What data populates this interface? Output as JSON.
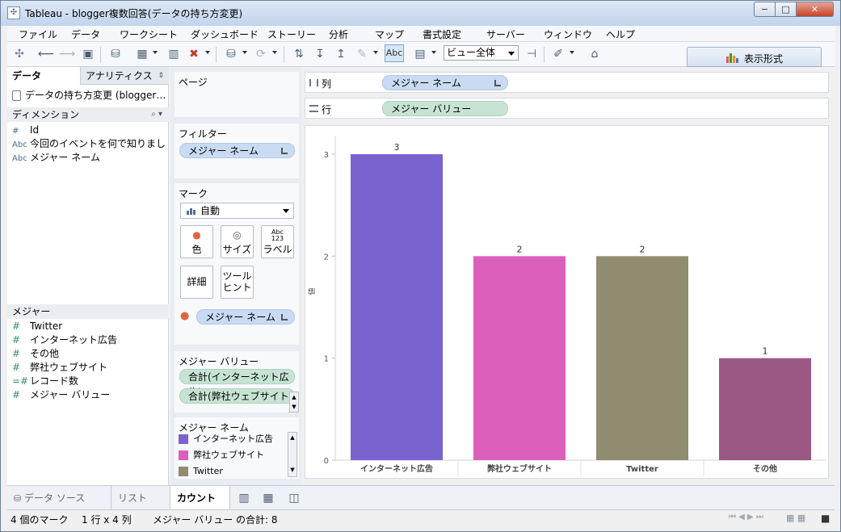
{
  "window": {
    "title": "Tableau - blogger複数回答(データの持ち方変更)",
    "min": "−",
    "max": "□",
    "close": "✕"
  },
  "menu": [
    "ファイル",
    "データ",
    "ワークシート",
    "ダッシュボード",
    "ストーリー",
    "分析",
    "マップ",
    "書式設定",
    "サーバー",
    "ウィンドウ",
    "ヘルプ"
  ],
  "toolbar": {
    "abc": "Abc",
    "view_select": "ビュー全体",
    "showme": "表示形式"
  },
  "left_pane": {
    "tab_data": "データ",
    "tab_analytics": "アナリティクス",
    "datasource": "データの持ち方変更 (blogger…",
    "dimensions_header": "ディメンション",
    "dimensions": [
      {
        "type": "#",
        "name": "Id"
      },
      {
        "type": "Abc",
        "name": "今回のイベントを何で知りました…"
      },
      {
        "type": "Abc",
        "name": "メジャー ネーム"
      }
    ],
    "measures_header": "メジャー",
    "measures": [
      {
        "type": "#",
        "name": "Twitter"
      },
      {
        "type": "#",
        "name": "インターネット広告"
      },
      {
        "type": "#",
        "name": "その他"
      },
      {
        "type": "#",
        "name": "弊社ウェブサイト"
      },
      {
        "type": "=#",
        "name": "レコード数"
      },
      {
        "type": "#",
        "name": "メジャー バリュー"
      }
    ]
  },
  "cards": {
    "pages": "ページ",
    "filters": "フィルター",
    "filter_pill": "メジャー ネーム",
    "marks": "マーク",
    "mark_type": "自動",
    "mark_buttons": [
      {
        "label": "色",
        "icon": "●"
      },
      {
        "label": "サイズ",
        "icon": "◎"
      },
      {
        "label": "ラベル",
        "icon": "Abc\n123"
      },
      {
        "label": "詳細",
        "icon": ""
      },
      {
        "label": "ツール\nヒント",
        "icon": ""
      }
    ],
    "color_pill": "メジャー ネーム",
    "measure_values_header": "メジャー バリュー",
    "measure_values_pills": [
      "合計(インターネット広告)",
      "合計(弊社ウェブサイト)"
    ],
    "legend_header": "メジャー ネーム",
    "legend_items": [
      {
        "name": "インターネット広告",
        "color": "#7b63cf"
      },
      {
        "name": "弊社ウェブサイト",
        "color": "#dc5fbc"
      },
      {
        "name": "Twitter",
        "color": "#908c70"
      }
    ]
  },
  "shelves": {
    "columns_label": "列",
    "columns_pill": "メジャー ネーム",
    "rows_label": "行",
    "rows_pill": "メジャー バリュー"
  },
  "chart_data": {
    "type": "bar",
    "categories": [
      "インターネット広告",
      "弊社ウェブサイト",
      "Twitter",
      "その他"
    ],
    "values": [
      3,
      2,
      2,
      1
    ],
    "data_labels": [
      "3",
      "2",
      "2",
      "1"
    ],
    "colors": [
      "#7b63cf",
      "#dc5fbc",
      "#908c70",
      "#9b5884"
    ],
    "ylabel": "値",
    "ylim": [
      0,
      3
    ],
    "yticks": [
      "0",
      "1",
      "2",
      "3"
    ],
    "title": ""
  },
  "status_tabs": [
    "データ ソース",
    "リスト",
    "カウント"
  ],
  "statusbar": {
    "marks": "4 個のマーク",
    "grid": "1 行 x 4 列",
    "sum": "メジャー バリュー の合計: 8"
  }
}
